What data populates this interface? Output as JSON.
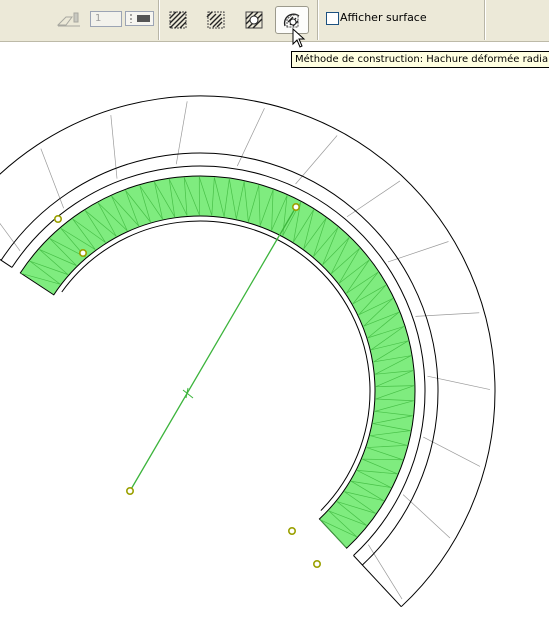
{
  "toolbar": {
    "pen_number": "1",
    "show_surface_label": "Afficher surface",
    "show_surface_checked": false,
    "active_tool": "hatch-radial-deformed",
    "tools": [
      {
        "name": "hatch-parallel-icon"
      },
      {
        "name": "hatch-deformed-icon"
      },
      {
        "name": "hatch-fit-icon"
      },
      {
        "name": "hatch-radial-deformed-icon"
      }
    ]
  },
  "tooltip": {
    "text": "Méthode de construction: Hachure déformée radiale"
  },
  "colors": {
    "hatch_fill": "#7fec7f",
    "hatch_stroke": "#48c048",
    "axis": "#3cb43c",
    "node": "#9aa000"
  }
}
